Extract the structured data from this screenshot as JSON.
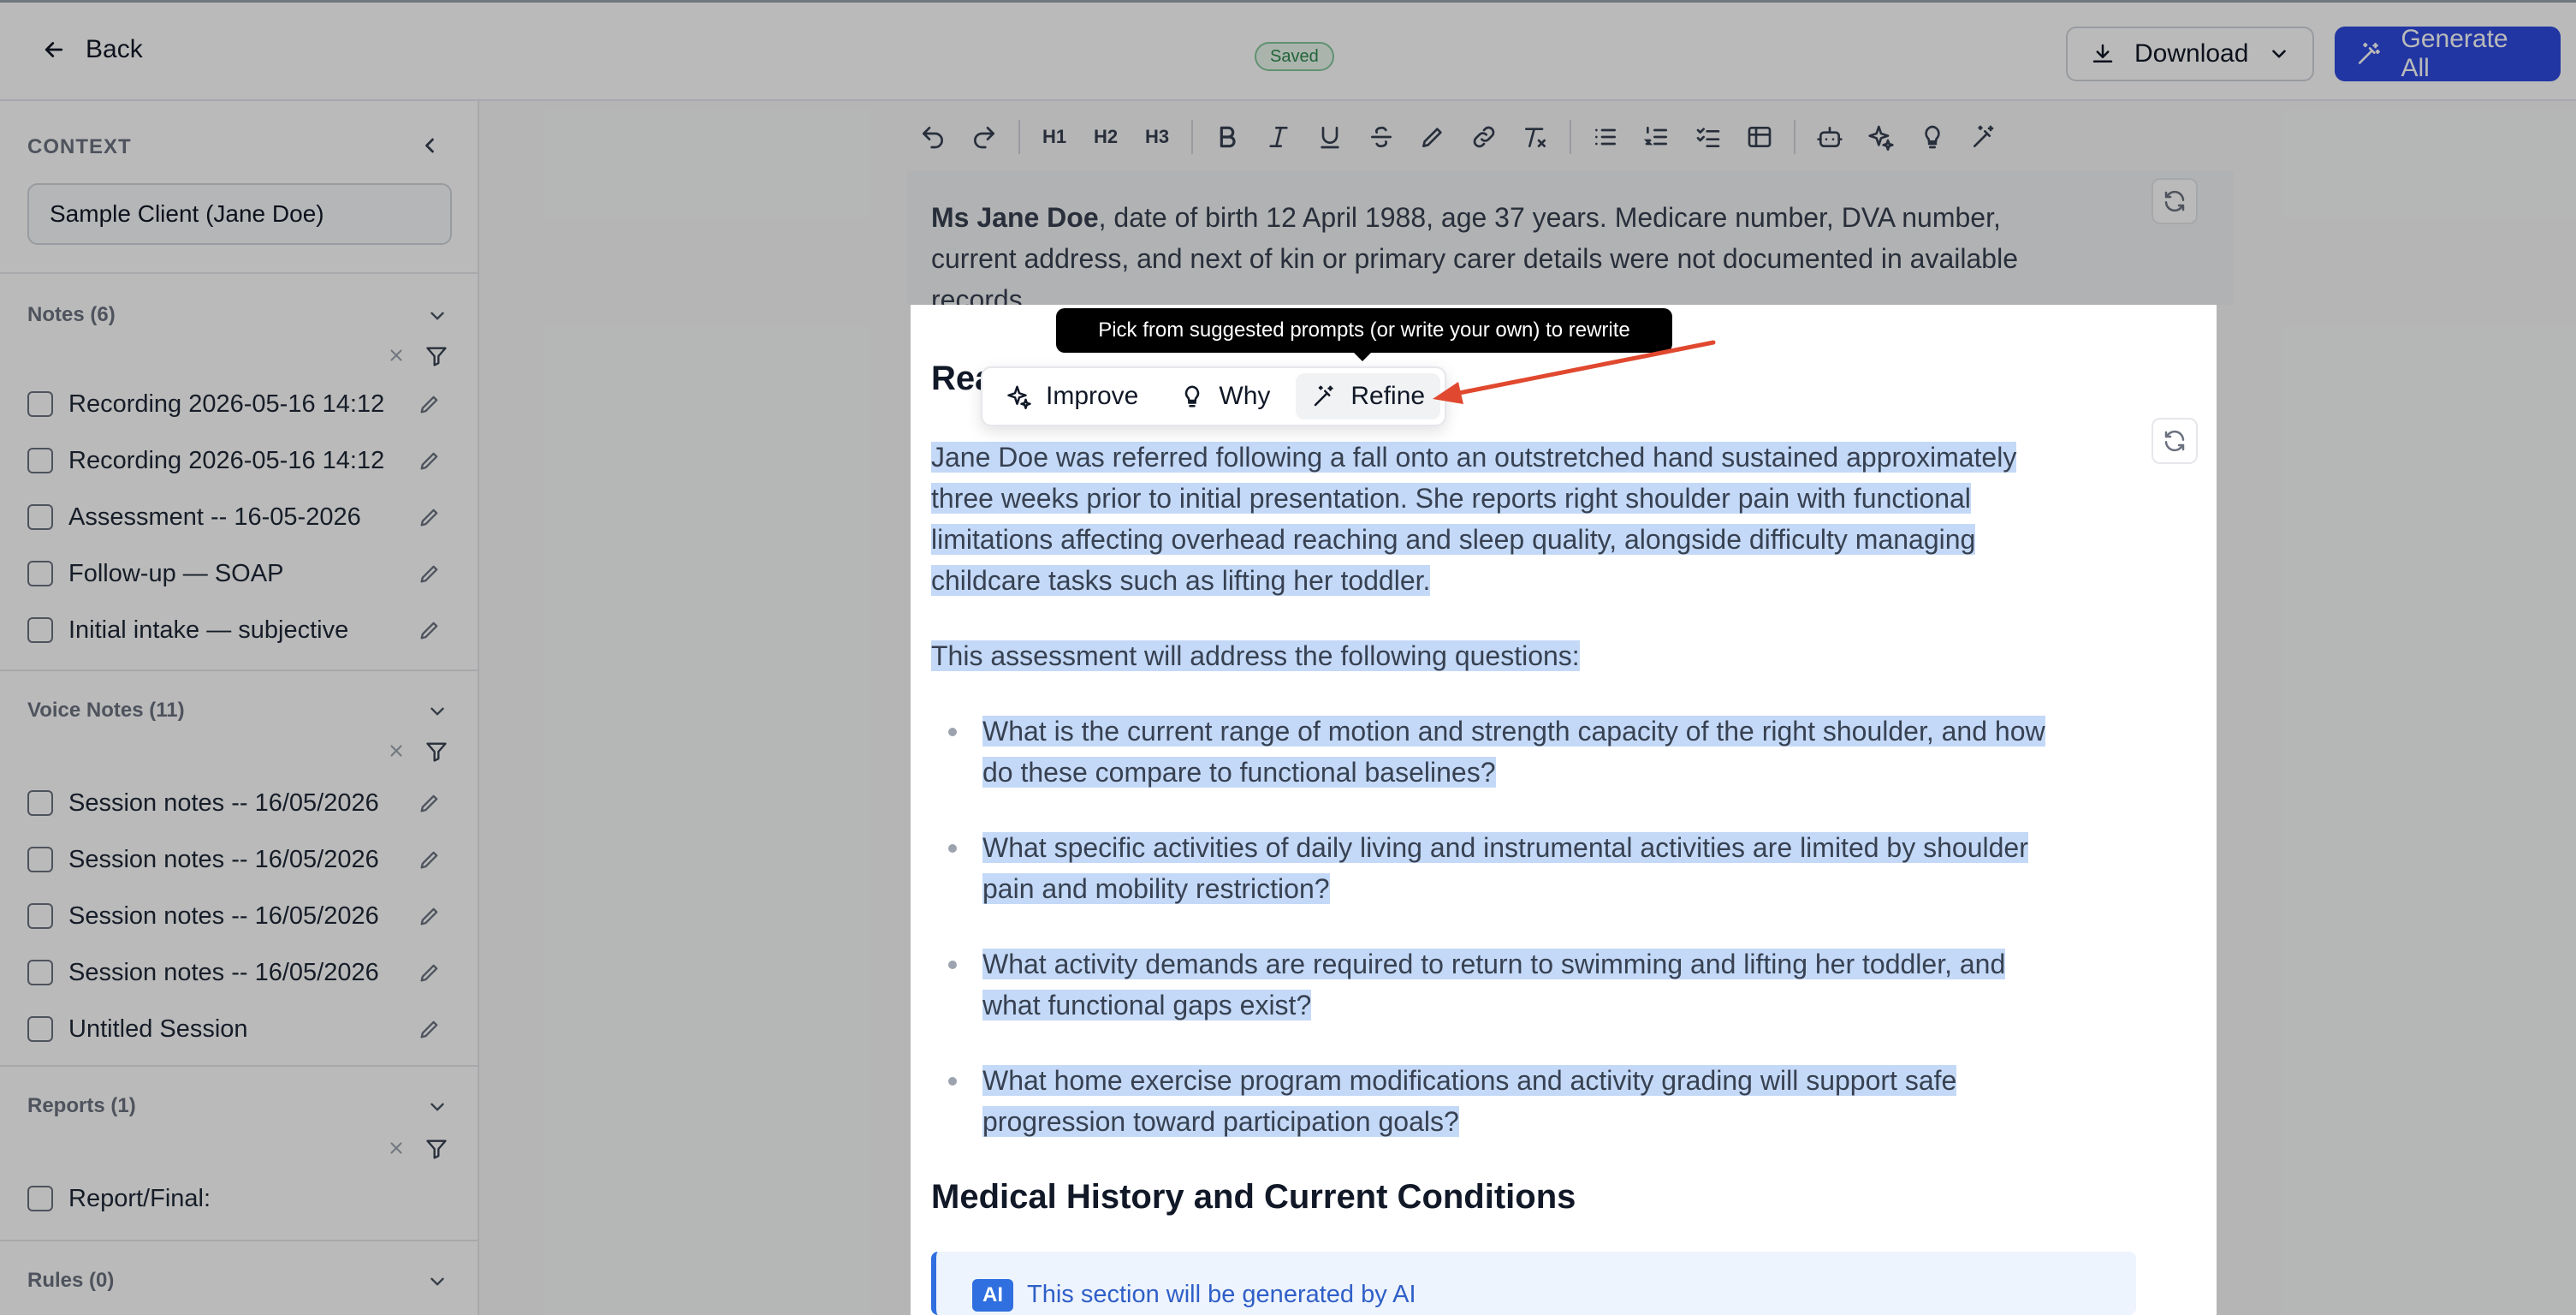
{
  "header": {
    "back_label": "Back",
    "status_badge": "Saved",
    "download_label": "Download",
    "generate_label": "Generate All"
  },
  "sidebar": {
    "context_label": "CONTEXT",
    "context_value": "Sample Client (Jane Doe)",
    "notes": {
      "title": "Notes (6)",
      "items": [
        "Recording 2026-05-16 14:12",
        "Recording 2026-05-16 14:12",
        "Assessment -- 16-05-2026",
        "Follow-up — SOAP",
        "Initial intake — subjective"
      ]
    },
    "voice_notes": {
      "title": "Voice Notes (11)",
      "items": [
        "Session notes -- 16/05/2026",
        "Session notes -- 16/05/2026",
        "Session notes -- 16/05/2026",
        "Session notes -- 16/05/2026",
        "Untitled Session"
      ]
    },
    "reports": {
      "title": "Reports (1)",
      "items": [
        "Report/Final:"
      ]
    },
    "rules": {
      "title": "Rules (0)"
    }
  },
  "toolbar": {
    "h1": "H1",
    "h2": "H2",
    "h3": "H3"
  },
  "document": {
    "intro_bold": "Ms Jane Doe",
    "intro_line1": ", date of birth 12 April 1988, age 37 years. Medicare number, DVA number,",
    "intro_line2": "current address, and next of kin or primary carer details were not documented in available",
    "intro_line3": "records.",
    "section1_heading_partial": "Rea",
    "para1": [
      "Jane Doe was referred following a fall onto an outstretched hand sustained approximately",
      "three weeks prior to initial presentation. She reports right shoulder pain with functional",
      "limitations affecting overhead reaching and sleep quality, alongside difficulty managing",
      "childcare tasks such as lifting her toddler."
    ],
    "para2": "This assessment will address the following questions:",
    "bullets": [
      [
        "What is the current range of motion and strength capacity of the right shoulder, and how",
        "do these compare to functional baselines?"
      ],
      [
        "What specific activities of daily living and instrumental activities are limited by shoulder",
        "pain and mobility restriction?"
      ],
      [
        "What activity demands are required to return to swimming and lifting her toddler, and",
        "what functional gaps exist?"
      ],
      [
        "What home exercise program modifications and activity grading will support safe",
        "progression toward participation goals?"
      ]
    ],
    "section2_heading": "Medical History and Current Conditions",
    "ai_badge": "AI",
    "ai_text": "This section will be generated by AI"
  },
  "bubble_menu": {
    "tooltip": "Pick from suggested prompts (or write your own) to rewrite",
    "improve": "Improve",
    "why": "Why",
    "refine": "Refine"
  },
  "colors": {
    "accent": "#2f4be0",
    "selection": "#c4d9f7",
    "annotation_arrow": "#e0492f",
    "saved_green": "#2f8a4c"
  }
}
